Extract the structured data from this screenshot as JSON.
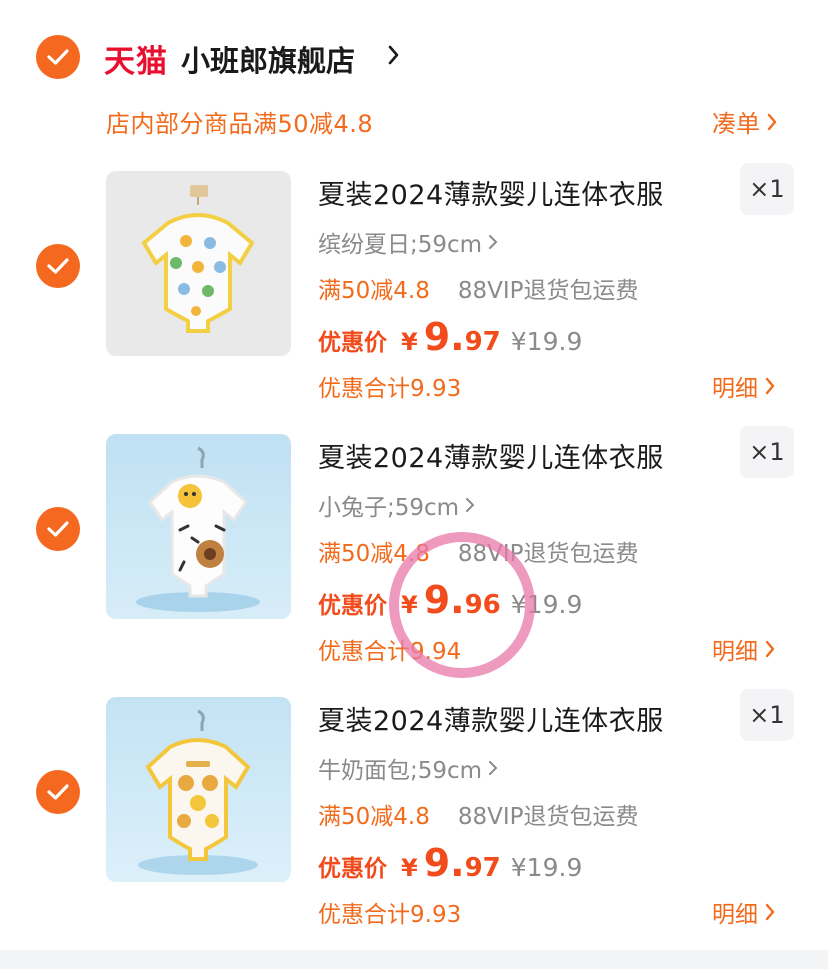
{
  "shop": {
    "platform_logo": "天猫",
    "name": "小班郎旗舰店",
    "promo": "店内部分商品满50减4.8",
    "cou_dan": "凑单"
  },
  "items": [
    {
      "title": "夏装2024薄款婴儿连体衣服",
      "qty": "×1",
      "spec": "缤纷夏日;59cm",
      "tag_discount": "满50减4.8",
      "tag_vip": "88VIP退货包运费",
      "price_label": "优惠价",
      "yen": "¥",
      "price_int": "9.",
      "price_dec": "97",
      "orig_price": "¥19.9",
      "saving": "优惠合计9.93",
      "detail": "明细"
    },
    {
      "title": "夏装2024薄款婴儿连体衣服",
      "qty": "×1",
      "spec": "小兔子;59cm",
      "tag_discount": "满50减4.8",
      "tag_vip": "88VIP退货包运费",
      "price_label": "优惠价",
      "yen": "¥",
      "price_int": "9.",
      "price_dec": "96",
      "orig_price": "¥19.9",
      "saving": "优惠合计9.94",
      "detail": "明细"
    },
    {
      "title": "夏装2024薄款婴儿连体衣服",
      "qty": "×1",
      "spec": "牛奶面包;59cm",
      "tag_discount": "满50减4.8",
      "tag_vip": "88VIP退货包运费",
      "price_label": "优惠价",
      "yen": "¥",
      "price_int": "9.",
      "price_dec": "97",
      "orig_price": "¥19.9",
      "saving": "优惠合计9.93",
      "detail": "明细"
    }
  ],
  "colors": {
    "accent": "#f26b1d",
    "price": "#f24c1d",
    "check": "#f5681f",
    "tmall": "#e8102f",
    "annotation": "#e878aa"
  }
}
